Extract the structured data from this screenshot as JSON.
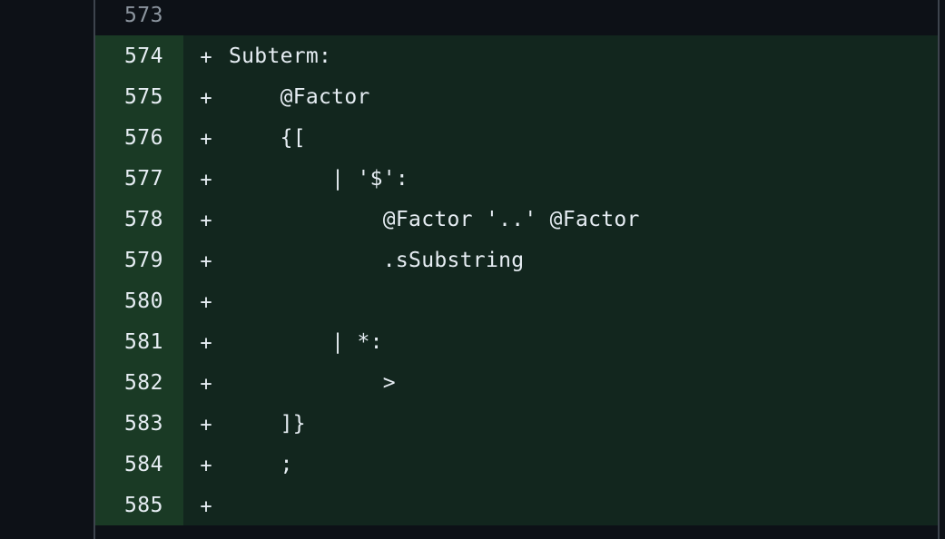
{
  "diff": {
    "lines": [
      {
        "num": "573",
        "marker": "",
        "code": "",
        "type": "context"
      },
      {
        "num": "574",
        "marker": "+",
        "code": "Subterm:",
        "type": "added"
      },
      {
        "num": "575",
        "marker": "+",
        "code": "    @Factor",
        "type": "added"
      },
      {
        "num": "576",
        "marker": "+",
        "code": "    {[",
        "type": "added"
      },
      {
        "num": "577",
        "marker": "+",
        "code": "        | '$':",
        "type": "added"
      },
      {
        "num": "578",
        "marker": "+",
        "code": "            @Factor '..' @Factor",
        "type": "added"
      },
      {
        "num": "579",
        "marker": "+",
        "code": "            .sSubstring",
        "type": "added"
      },
      {
        "num": "580",
        "marker": "+",
        "code": "",
        "type": "added"
      },
      {
        "num": "581",
        "marker": "+",
        "code": "        | *:",
        "type": "added"
      },
      {
        "num": "582",
        "marker": "+",
        "code": "            >",
        "type": "added"
      },
      {
        "num": "583",
        "marker": "+",
        "code": "    ]}",
        "type": "added"
      },
      {
        "num": "584",
        "marker": "+",
        "code": "    ;",
        "type": "added"
      },
      {
        "num": "585",
        "marker": "+",
        "code": "",
        "type": "added"
      }
    ]
  },
  "colors": {
    "background": "#0d1117",
    "added_row": "#12261e",
    "added_gutter": "#1a3a25",
    "text": "#e6edf3",
    "border": "#3d444d"
  }
}
